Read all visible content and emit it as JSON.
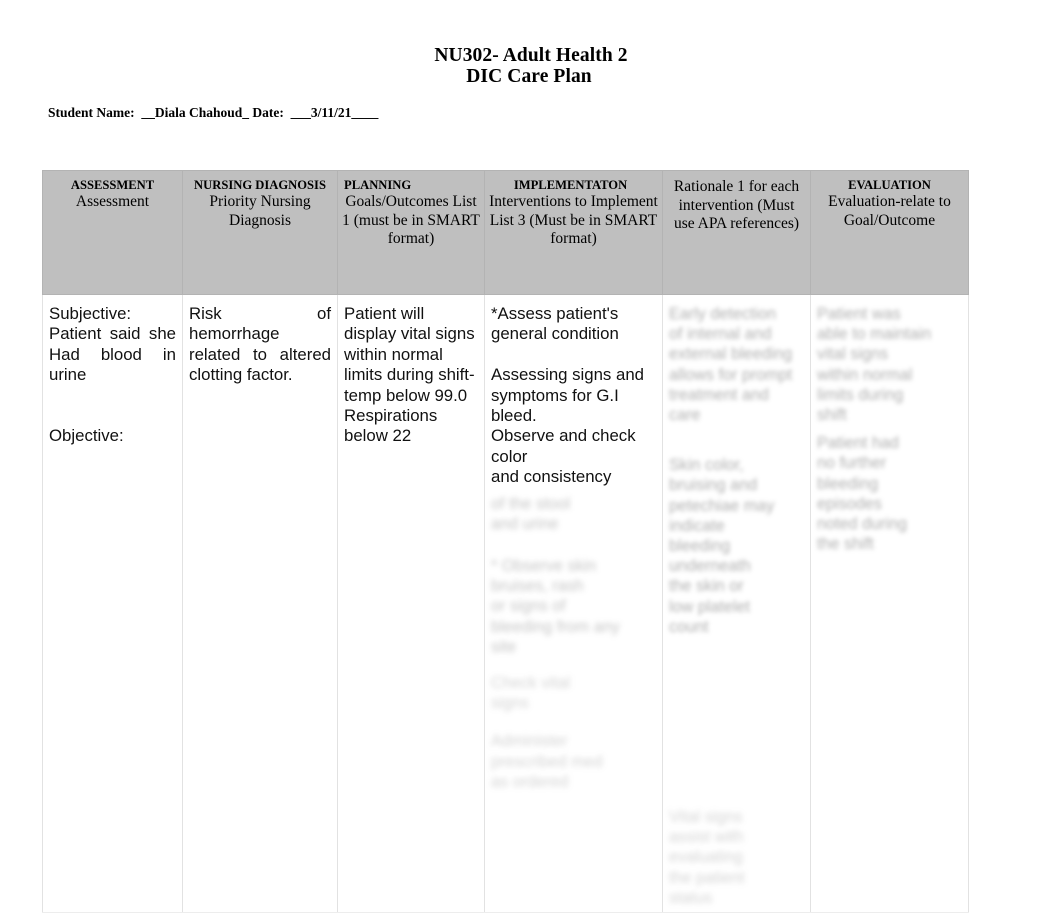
{
  "document": {
    "title_line1": "NU302- Adult Health 2",
    "title_line2": "DIC Care Plan",
    "student_line": "Student Name:  __Diala Chahoud_ Date:  ___3/11/21____"
  },
  "table": {
    "columns": [
      {
        "key": "assessment",
        "header_caps": "ASSESSMENT",
        "header_sub": "Assessment"
      },
      {
        "key": "nursing_diagnosis",
        "header_caps": "NURSING DIAGNOSIS",
        "header_sub": "Priority\nNursing Diagnosis"
      },
      {
        "key": "planning",
        "header_caps": "PLANNING",
        "header_sub": "Goals/Outcomes\nList 1\n(must be in SMART\nformat)"
      },
      {
        "key": "implementation",
        "header_caps": "IMPLEMENTATON",
        "header_sub": "Interventions to\nImplement\nList 3\n(Must be in SMART\nformat)"
      },
      {
        "key": "rationale",
        "header_caps": "",
        "header_sub": "Rationale\n1 for each\nintervention\n(Must use APA\nreferences)"
      },
      {
        "key": "evaluation",
        "header_caps": "EVALUATION",
        "header_sub": "Evaluation-relate to\nGoal/Outcome"
      }
    ],
    "row": {
      "assessment": "Subjective:\nPatient said she Had blood in urine",
      "assessment_objective": "Objective:",
      "nursing_diagnosis": "Risk  of hemorrhage related to altered clotting factor.",
      "planning": "Patient will display vital signs within normal limits during shift- temp below 99.0 Respirations below 22",
      "implementation_part1": "*Assess patient's general condition",
      "implementation_part2": "Assessing signs and symptoms for G.I bleed.\nObserve and check color\nand consistency",
      "implementation_faded_1": "of the stool\nand urine",
      "implementation_faded_2": "* Observe skin\nbruises, rash\nor signs of\nbleeding from any\nsite",
      "implementation_faded_3": "Check vital\nsigns",
      "implementation_faded_4": "Administer\nprescribed med\nas ordered",
      "rationale_faded_1": "Early detection\nof internal and\nexternal bleeding\nallows for prompt\ntreatment and\ncare",
      "rationale_faded_2": "Skin color,\nbruising and\npetechiae may\nindicate\nbleeding\nunderneath\nthe skin or\nlow platelet\ncount",
      "rationale_faded_3": "Vital signs\nassist with\nevaluating\nthe patient\nstatus",
      "evaluation_faded_1": "Patient was\nable to maintain\nvital signs\nwithin normal\nlimits during\nshift",
      "evaluation_faded_2": "Patient had\nno further\nbleeding\nepisodes\nnoted during\nthe shift"
    }
  },
  "colors": {
    "header_background": "#BFBFBF",
    "page_background": "#FFFFFF",
    "text": "#000000",
    "border": "#D9D9D9"
  }
}
